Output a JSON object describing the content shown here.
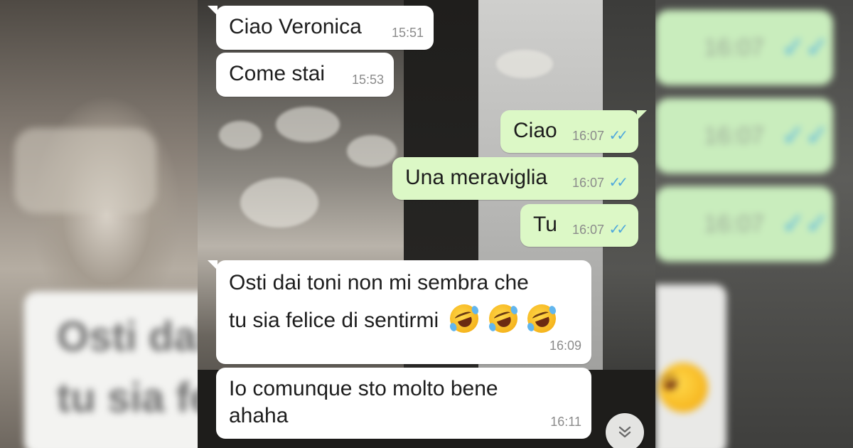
{
  "blurred_background": {
    "left_line1": "Osti dai",
    "left_line2": "tu sia fe",
    "right_times": [
      "16:07",
      "16:07",
      "16:07"
    ]
  },
  "messages": [
    {
      "direction": "in",
      "text": "Ciao Veronica",
      "time": "15:51"
    },
    {
      "direction": "in",
      "text": "Come stai",
      "time": "15:53"
    },
    {
      "direction": "out",
      "text": "Ciao",
      "time": "16:07",
      "status_icon": "double-check-read-icon"
    },
    {
      "direction": "out",
      "text": "Una meraviglia",
      "time": "16:07",
      "status_icon": "double-check-read-icon"
    },
    {
      "direction": "out",
      "text": "Tu",
      "time": "16:07",
      "status_icon": "double-check-read-icon"
    },
    {
      "direction": "in",
      "line1": "Osti dai toni non mi sembra che",
      "line2": "tu sia felice di sentirmi",
      "emoji": [
        "rolling-on-floor-laughing-emoji",
        "rolling-on-floor-laughing-emoji",
        "rolling-on-floor-laughing-emoji"
      ],
      "time": "16:09"
    },
    {
      "direction": "in",
      "line1": "Io comunque sto molto bene",
      "line2": "ahaha",
      "time": "16:11"
    }
  ],
  "scroll_button_icon": "double-chevron-down-icon",
  "colors": {
    "incoming_bubble": "#ffffff",
    "outgoing_bubble": "#dcf8c6",
    "read_ticks": "#4fa8dc",
    "timestamp": "#8b8b8b"
  }
}
